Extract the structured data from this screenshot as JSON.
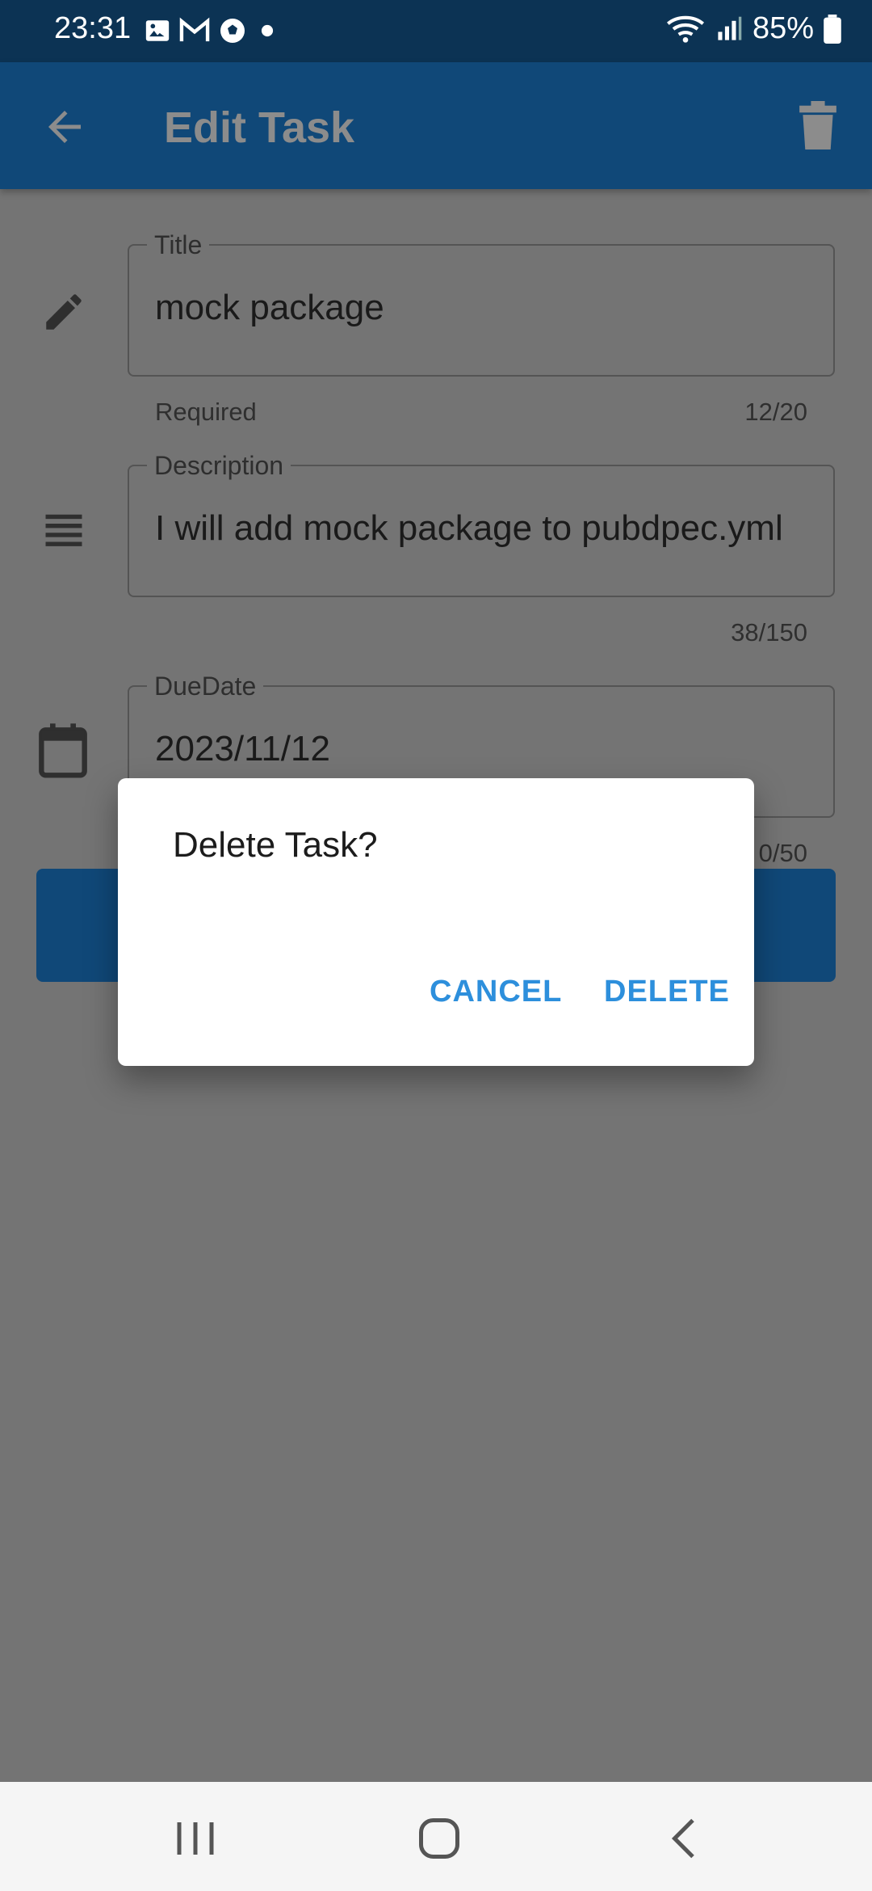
{
  "status_bar": {
    "time": "23:31",
    "battery": "85%"
  },
  "app_bar": {
    "title": "Edit Task"
  },
  "form": {
    "title": {
      "label": "Title",
      "value": "mock package",
      "helper": "Required",
      "counter": "12/20"
    },
    "description": {
      "label": "Description",
      "value": "I will add mock package to pubdpec.yml",
      "counter": "38/150"
    },
    "due_date": {
      "label": "DueDate",
      "value": "2023/11/12",
      "counter": "0/50"
    }
  },
  "dialog": {
    "title": "Delete Task?",
    "cancel_label": "CANCEL",
    "delete_label": "DELETE"
  },
  "colors": {
    "app_bar": "#104878",
    "status_bar": "#0c3354",
    "accent": "#2d8fdc",
    "scrim_background": "#747474"
  },
  "icons": [
    "gallery-icon",
    "gmail-icon",
    "soccer-icon",
    "dot-icon",
    "wifi-icon",
    "signal-icon",
    "battery-icon",
    "back-arrow-icon",
    "trash-icon",
    "pencil-icon",
    "notes-icon",
    "calendar-icon",
    "recent-apps-icon",
    "home-icon",
    "nav-back-icon"
  ]
}
